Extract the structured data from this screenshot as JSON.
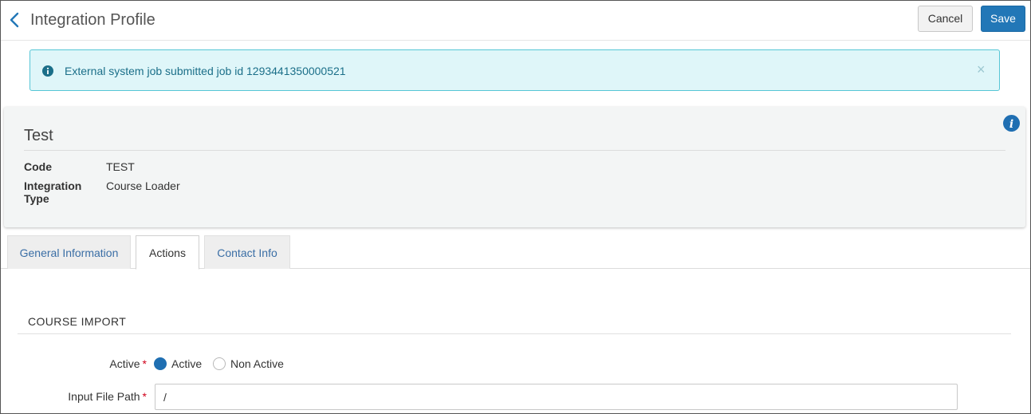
{
  "header": {
    "title": "Integration Profile",
    "cancel_label": "Cancel",
    "save_label": "Save"
  },
  "alert": {
    "message": "External system job submitted job id 1293441350000521",
    "close_glyph": "×"
  },
  "summary": {
    "title": "Test",
    "fields": [
      {
        "label": "Code",
        "value": "TEST"
      },
      {
        "label": "Integration Type",
        "value": "Course Loader"
      }
    ]
  },
  "tabs": [
    {
      "label": "General Information",
      "active": false
    },
    {
      "label": "Actions",
      "active": true
    },
    {
      "label": "Contact Info",
      "active": false
    }
  ],
  "section": {
    "title": "COURSE IMPORT"
  },
  "form": {
    "active_label": "Active",
    "required_mark": "*",
    "radio_options": [
      {
        "label": "Active",
        "selected": true
      },
      {
        "label": "Non Active",
        "selected": false
      }
    ],
    "input_file_path_label": "Input File Path",
    "input_file_path_value": "/"
  },
  "colors": {
    "primary": "#2277b7",
    "alert_bg": "#dff6f9",
    "alert_border": "#56c6d6",
    "required": "#d0021b"
  },
  "icons": {
    "back": "chevron-left-icon",
    "alert": "info-circle-icon",
    "summary_info": "info-circle-icon",
    "close": "close-icon"
  }
}
